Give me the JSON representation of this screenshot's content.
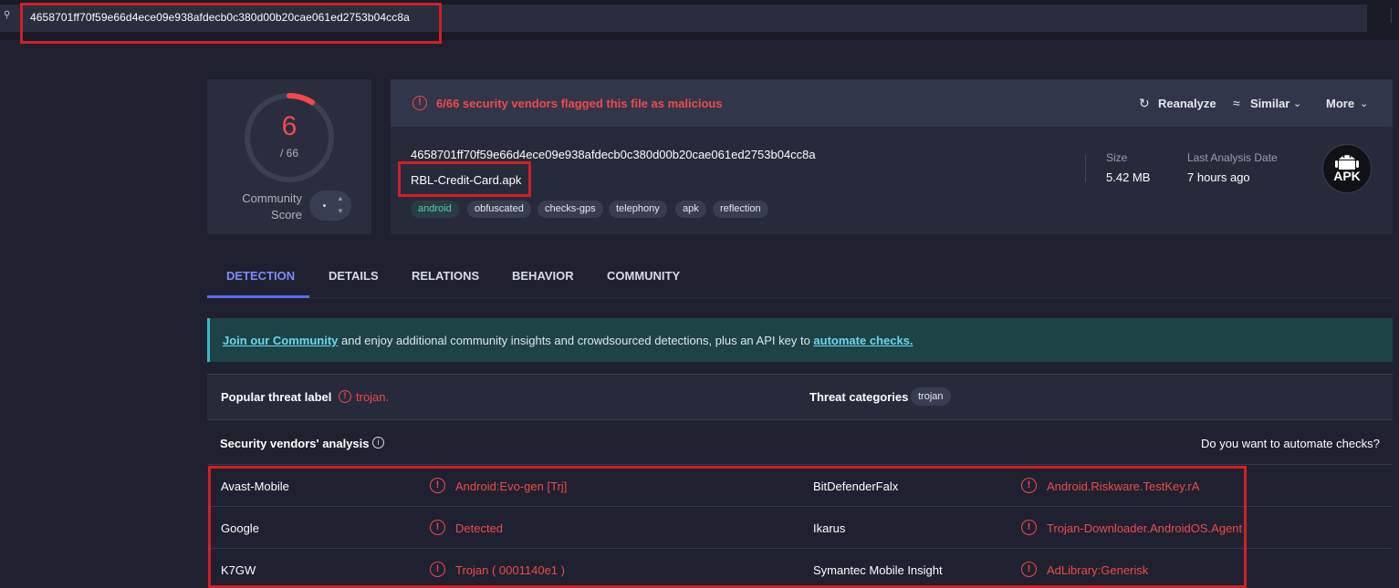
{
  "search": {
    "query": "4658701ff70f59e66d4ece09e938afdecb0c380d00b20cae061ed2753b04cc8a"
  },
  "score": {
    "detections": "6",
    "total": "/ 66",
    "community_label_1": "Community",
    "community_label_2": "Score",
    "detections_fraction": 0.0909
  },
  "header": {
    "alert": "6/66 security vendors flagged this file as malicious",
    "reanalyze": "Reanalyze",
    "similar": "Similar",
    "more": "More"
  },
  "file": {
    "hash": "4658701ff70f59e66d4ece09e938afdecb0c380d00b20cae061ed2753b04cc8a",
    "name": "RBL-Credit-Card.apk",
    "tags": [
      "android",
      "obfuscated",
      "checks-gps",
      "telephony",
      "apk",
      "reflection"
    ],
    "size_label": "Size",
    "size_value": "5.42 MB",
    "last_label": "Last Analysis Date",
    "last_value": "7 hours ago",
    "type_badge": "APK"
  },
  "tabs": [
    "DETECTION",
    "DETAILS",
    "RELATIONS",
    "BEHAVIOR",
    "COMMUNITY"
  ],
  "banner": {
    "link1": "Join our Community",
    "middle": " and enjoy additional community insights and crowdsourced detections, plus an API key to ",
    "link2": "automate checks."
  },
  "threat": {
    "popular_label": "Popular threat label",
    "popular_value": "trojan.",
    "categories_label": "Threat categories",
    "categories_value": "trojan"
  },
  "vendors_section": {
    "title": "Security vendors' analysis",
    "automate": "Do you want to automate checks?"
  },
  "vendors": [
    {
      "left_name": "Avast-Mobile",
      "left_result": "Android:Evo-gen [Trj]",
      "right_name": "BitDefenderFalx",
      "right_result": "Android.Riskware.TestKey.rA"
    },
    {
      "left_name": "Google",
      "left_result": "Detected",
      "right_name": "Ikarus",
      "right_result": "Trojan-Downloader.AndroidOS.Agent"
    },
    {
      "left_name": "K7GW",
      "left_result": "Trojan ( 0001140e1 )",
      "right_name": "Symantec Mobile Insight",
      "right_result": "AdLibrary:Generisk"
    }
  ],
  "colors": {
    "malicious": "#f14a4a",
    "accent": "#5b6cf3",
    "highlight_box": "#d11f26"
  }
}
